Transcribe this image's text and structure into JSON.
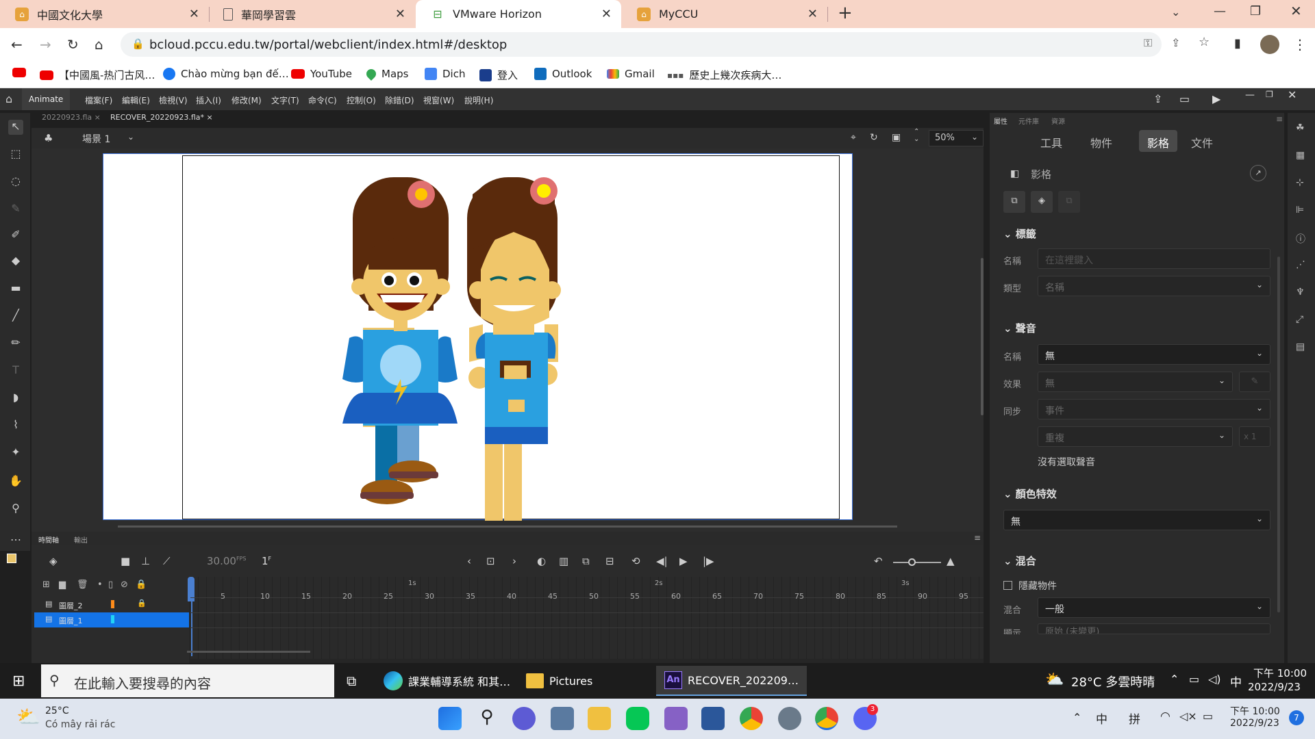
{
  "browser": {
    "tabs": [
      {
        "title": "中國文化大學",
        "icon": "school-icon"
      },
      {
        "title": "華岡學習雲",
        "icon": "document-icon"
      },
      {
        "title": "VMware Horizon",
        "icon": "vmware-icon"
      },
      {
        "title": "MyCCU",
        "icon": "school-icon"
      }
    ],
    "new_tab": "+",
    "url": "bcloud.pccu.edu.tw/portal/webclient/index.html#/desktop",
    "bookmarks": [
      "【中國風-热门古风…",
      "Chào mừng bạn đế…",
      "YouTube",
      "Maps",
      "Dich",
      "登入",
      "Outlook",
      "Gmail",
      "歷史上幾次疾病大…"
    ]
  },
  "animate": {
    "app_name": "Animate",
    "menus": [
      "檔案(F)",
      "編輯(E)",
      "檢視(V)",
      "插入(I)",
      "修改(M)",
      "文字(T)",
      "命令(C)",
      "控制(O)",
      "除錯(D)",
      "視窗(W)",
      "說明(H)"
    ],
    "doc_tabs": [
      "20220923.fla",
      "RECOVER_20220923.fla*"
    ],
    "scene": "場景 1",
    "zoom": "50%",
    "timeline": {
      "tabs": [
        "時間軸",
        "輸出"
      ],
      "fps": "30.00",
      "fps_unit": "FPS",
      "frame": "1",
      "frame_unit": "F",
      "seconds": [
        "1s",
        "2s",
        "3s"
      ],
      "frame_numbers": [
        "5",
        "10",
        "15",
        "20",
        "25",
        "30",
        "35",
        "40",
        "45",
        "50",
        "55",
        "60",
        "65",
        "70",
        "75",
        "80",
        "85",
        "90",
        "95"
      ],
      "layers": [
        {
          "name": "圖層_2",
          "color": "#ff8c1a"
        },
        {
          "name": "圖層_1",
          "color": "#21d4f5"
        }
      ]
    },
    "props": {
      "panel_tabs": [
        "屬性",
        "元件庫",
        "資源"
      ],
      "tabs": [
        "工具",
        "物件",
        "影格",
        "文件"
      ],
      "active_tab": "影格",
      "heading": "影格",
      "label_section": "標籤",
      "name_label": "名稱",
      "name_placeholder": "在這裡鍵入",
      "type_label": "類型",
      "type_value": "名稱",
      "sound_section": "聲音",
      "sound_name_label": "名稱",
      "sound_name_value": "無",
      "effect_label": "效果",
      "effect_value": "無",
      "sync_label": "同步",
      "sync_value": "事件",
      "repeat_value": "重複",
      "repeat_count": "x 1",
      "no_sound": "沒有選取聲音",
      "color_section": "顏色特效",
      "color_value": "無",
      "blend_section": "混合",
      "hide_object": "隱藏物件",
      "blend_label": "混合",
      "blend_value": "一般",
      "render_label": "顯示",
      "render_value": "原始 (未變更)"
    }
  },
  "vm_taskbar": {
    "search_placeholder": "在此輸入要搜尋的內容",
    "apps": [
      "課業輔導系統 和其…",
      "Pictures",
      "RECOVER_202209…"
    ],
    "weather": "28°C 多雲時晴",
    "ime": "中",
    "time": "下午 10:00",
    "date": "2022/9/23"
  },
  "host_taskbar": {
    "temp": "25°C",
    "weather": "Có mây rải rác",
    "ime1": "中",
    "ime2": "拼",
    "time": "下午 10:00",
    "date": "2022/9/23",
    "notif": "7",
    "discord_badge": "3"
  }
}
